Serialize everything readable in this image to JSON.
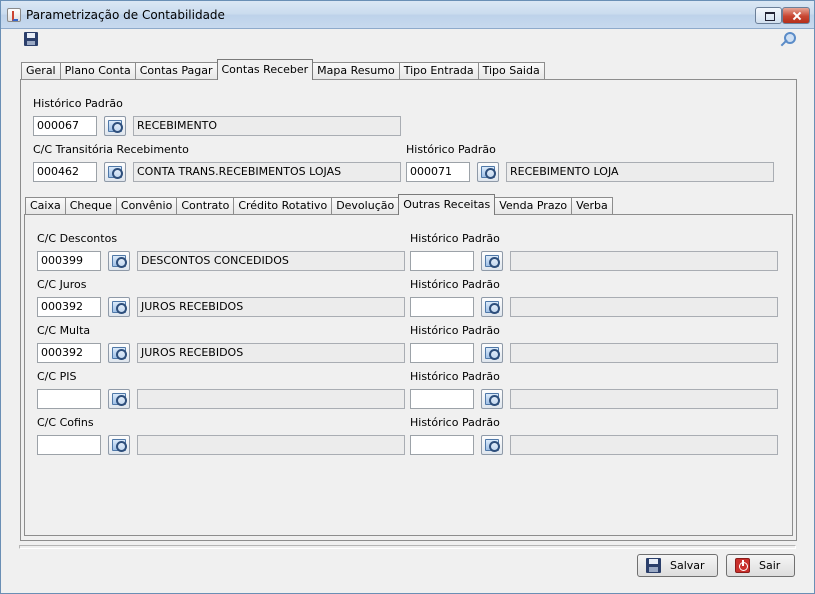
{
  "window": {
    "title": "Parametrização de Contabilidade"
  },
  "main_tabs": [
    "Geral",
    "Plano Conta",
    "Contas Pagar",
    "Contas Receber",
    "Mapa Resumo",
    "Tipo Entrada",
    "Tipo Saida"
  ],
  "main_active": "Contas Receber",
  "contas_receber": {
    "historico_padrao": {
      "label": "Histórico Padrão",
      "code": "000067",
      "desc": "RECEBIMENTO"
    },
    "cc_transitoria": {
      "label": "C/C Transitória Recebimento",
      "code": "000462",
      "desc": "CONTA TRANS.RECEBIMENTOS LOJAS"
    },
    "historico_padrao_2": {
      "label": "Histórico Padrão",
      "code": "000071",
      "desc": "RECEBIMENTO LOJA"
    }
  },
  "sub_tabs": [
    "Caixa",
    "Cheque",
    "Convênio",
    "Contrato",
    "Crédito Rotativo",
    "Devolução",
    "Outras Receitas",
    "Venda Prazo",
    "Verba"
  ],
  "sub_active": "Outras Receitas",
  "outras_receitas": {
    "rows": [
      {
        "label": "C/C Descontos",
        "code": "000399",
        "desc": "DESCONTOS CONCEDIDOS",
        "hist_label": "Histórico Padrão",
        "hist_code": "",
        "hist_desc": ""
      },
      {
        "label": "C/C Juros",
        "code": "000392",
        "desc": "JUROS RECEBIDOS",
        "hist_label": "Histórico Padrão",
        "hist_code": "",
        "hist_desc": ""
      },
      {
        "label": "C/C Multa",
        "code": "000392",
        "desc": "JUROS RECEBIDOS",
        "hist_label": "Histórico Padrão",
        "hist_code": "",
        "hist_desc": ""
      },
      {
        "label": "C/C PIS",
        "code": "",
        "desc": "",
        "hist_label": "Histórico Padrão",
        "hist_code": "",
        "hist_desc": ""
      },
      {
        "label": "C/C Cofins",
        "code": "",
        "desc": "",
        "hist_label": "Histórico Padrão",
        "hist_code": "",
        "hist_desc": ""
      }
    ]
  },
  "buttons": {
    "save": "Salvar",
    "exit": "Sair"
  }
}
